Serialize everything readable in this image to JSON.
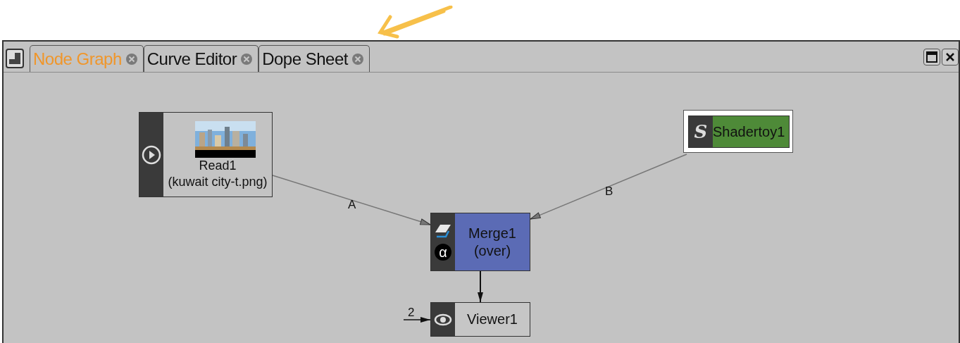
{
  "tabs": [
    {
      "label": "Node Graph",
      "selected": true
    },
    {
      "label": "Curve Editor",
      "selected": false
    },
    {
      "label": "Dope Sheet",
      "selected": false
    }
  ],
  "nodes": [
    {
      "kind": "read",
      "label": "Read1",
      "sublabel": "(kuwait city-t.png)",
      "color": "#c3c3c3"
    },
    {
      "kind": "shader",
      "icon_char": "S",
      "label": "Shadertoy1",
      "color": "#4e8a38"
    },
    {
      "kind": "merge",
      "icon_char": "α",
      "label": "Merge1",
      "sublabel": "(over)",
      "color": "#5b6bb5"
    },
    {
      "kind": "viewer",
      "label": "Viewer1",
      "input_label": "2",
      "color": "#c6c6c6"
    }
  ],
  "edges": [
    {
      "kind": "input",
      "label": "A"
    },
    {
      "kind": "input",
      "label": "B"
    },
    {
      "kind": "output"
    }
  ]
}
